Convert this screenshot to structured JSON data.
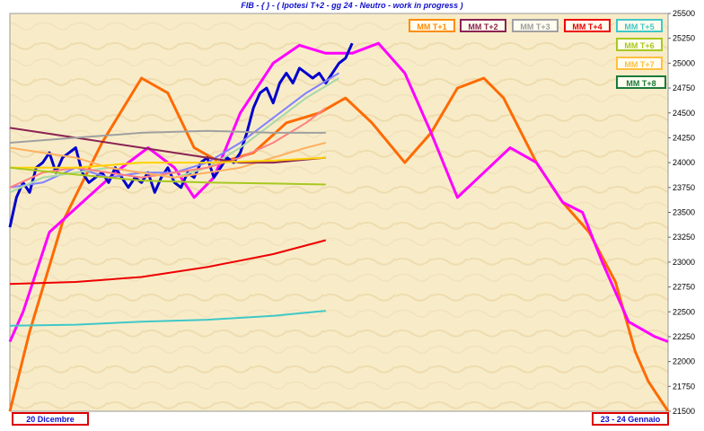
{
  "chart_data": {
    "type": "line",
    "title": "FIB  -  {  }  - ( Ipotesi  T+2 -  gg 24   -  Neutro -  work in progress )",
    "ylim": [
      21500,
      25500
    ],
    "y_ticks": [
      21500,
      21750,
      22000,
      22250,
      22500,
      22750,
      23000,
      23250,
      23500,
      23750,
      24000,
      24250,
      24500,
      24750,
      25000,
      25250,
      25500
    ],
    "x_start_label": "20  Dicembre",
    "x_end_label": "23 - 24  Gennaio",
    "grid": false,
    "legend_position": "top-right",
    "legend": [
      {
        "label": "MM  T+1",
        "color": "#ff8c00"
      },
      {
        "label": "MM  T+2",
        "color": "#8b2252"
      },
      {
        "label": "MM  T+3",
        "color": "#a0a0a0"
      },
      {
        "label": "MM  T+4",
        "color": "#ee0000"
      },
      {
        "label": "MM  T+5",
        "color": "#40c8c8"
      },
      {
        "label": "MM  T+6",
        "color": "#a8c820"
      },
      {
        "label": "MM  T+7",
        "color": "#ffc040"
      },
      {
        "label": "MM  T+8",
        "color": "#1a7a3a"
      }
    ],
    "series": [
      {
        "color": "#ff6a00",
        "x": [
          0,
          0.03,
          0.08,
          0.14,
          0.2,
          0.24,
          0.28,
          0.32,
          0.37,
          0.42,
          0.47,
          0.51,
          0.55,
          0.6,
          0.64,
          0.68,
          0.72,
          0.75,
          0.8,
          0.84,
          0.88,
          0.92,
          0.95,
          0.97,
          1.0
        ],
        "y": [
          21500,
          22300,
          23400,
          24200,
          24850,
          24700,
          24150,
          24000,
          24100,
          24400,
          24500,
          24650,
          24400,
          24000,
          24300,
          24750,
          24850,
          24650,
          24000,
          23600,
          23300,
          22800,
          22100,
          21800,
          21500
        ]
      },
      {
        "color": "#ff00ff",
        "x": [
          0,
          0.02,
          0.06,
          0.11,
          0.16,
          0.21,
          0.25,
          0.28,
          0.31,
          0.35,
          0.4,
          0.44,
          0.48,
          0.52,
          0.56,
          0.6,
          0.64,
          0.68,
          0.72,
          0.76,
          0.8,
          0.84,
          0.87,
          0.9,
          0.94,
          0.98,
          1.0
        ],
        "y": [
          22200,
          22500,
          23300,
          23600,
          23900,
          24150,
          23950,
          23650,
          23850,
          24500,
          25000,
          25180,
          25100,
          25100,
          25200,
          24900,
          24300,
          23650,
          23900,
          24150,
          24000,
          23600,
          23500,
          23000,
          22400,
          22250,
          22200
        ]
      },
      {
        "color": "#0000cc",
        "x": [
          0,
          0.01,
          0.02,
          0.03,
          0.04,
          0.05,
          0.06,
          0.07,
          0.08,
          0.09,
          0.1,
          0.11,
          0.12,
          0.13,
          0.14,
          0.15,
          0.16,
          0.17,
          0.18,
          0.19,
          0.2,
          0.21,
          0.22,
          0.23,
          0.24,
          0.25,
          0.26,
          0.27,
          0.28,
          0.29,
          0.3,
          0.31,
          0.32,
          0.33,
          0.34,
          0.35,
          0.36,
          0.37,
          0.38,
          0.39,
          0.4,
          0.41,
          0.42,
          0.43,
          0.44,
          0.45,
          0.46,
          0.47,
          0.48,
          0.49,
          0.5,
          0.51,
          0.52
        ],
        "y": [
          23350,
          23650,
          23800,
          23700,
          23950,
          24000,
          24100,
          23900,
          24050,
          24100,
          24150,
          23900,
          23800,
          23850,
          23900,
          23800,
          23950,
          23850,
          23750,
          23850,
          23800,
          23900,
          23700,
          23850,
          23950,
          23800,
          23750,
          23900,
          23850,
          24000,
          24050,
          23850,
          23950,
          24050,
          24000,
          24100,
          24300,
          24550,
          24700,
          24750,
          24600,
          24800,
          24900,
          24800,
          24950,
          24900,
          24850,
          24900,
          24800,
          24900,
          25000,
          25050,
          25200
        ]
      },
      {
        "color": "#8080ff",
        "x": [
          0,
          0.05,
          0.1,
          0.15,
          0.2,
          0.25,
          0.3,
          0.35,
          0.4,
          0.45,
          0.5
        ],
        "y": [
          23750,
          23800,
          23950,
          23850,
          23900,
          23900,
          24000,
          24200,
          24450,
          24700,
          24900
        ]
      },
      {
        "color": "#a8d8a8",
        "x": [
          0,
          0.05,
          0.1,
          0.15,
          0.2,
          0.25,
          0.3,
          0.35,
          0.4,
          0.45,
          0.5
        ],
        "y": [
          23700,
          23850,
          23900,
          23950,
          23900,
          23850,
          23950,
          24150,
          24400,
          24650,
          24850
        ]
      },
      {
        "color": "#ff8080",
        "x": [
          0,
          0.05,
          0.1,
          0.15,
          0.2,
          0.25,
          0.3,
          0.35,
          0.4,
          0.45,
          0.48
        ],
        "y": [
          23750,
          23900,
          23950,
          23900,
          23850,
          23900,
          23950,
          24050,
          24200,
          24400,
          24550
        ]
      },
      {
        "color": "#ffb060",
        "x": [
          0,
          0.05,
          0.1,
          0.15,
          0.2,
          0.25,
          0.3,
          0.35,
          0.4,
          0.45,
          0.48
        ],
        "y": [
          24150,
          24100,
          24050,
          23950,
          23900,
          23850,
          23900,
          23950,
          24050,
          24150,
          24200
        ]
      },
      {
        "color": "#8b2252",
        "x": [
          0,
          0.1,
          0.2,
          0.3,
          0.35,
          0.4,
          0.48
        ],
        "y": [
          24350,
          24250,
          24150,
          24050,
          24000,
          24000,
          24050
        ]
      },
      {
        "color": "#a0a0a0",
        "x": [
          0,
          0.1,
          0.2,
          0.3,
          0.4,
          0.48
        ],
        "y": [
          24200,
          24250,
          24300,
          24320,
          24300,
          24300
        ]
      },
      {
        "color": "#ffd000",
        "x": [
          0,
          0.1,
          0.2,
          0.3,
          0.4,
          0.48
        ],
        "y": [
          23950,
          23950,
          24000,
          24000,
          24020,
          24050
        ]
      },
      {
        "color": "#a8c820",
        "x": [
          0,
          0.1,
          0.2,
          0.3,
          0.4,
          0.48
        ],
        "y": [
          23950,
          23880,
          23820,
          23800,
          23790,
          23780
        ]
      },
      {
        "color": "#ee0000",
        "x": [
          0,
          0.1,
          0.2,
          0.3,
          0.4,
          0.48
        ],
        "y": [
          22780,
          22800,
          22850,
          22950,
          23080,
          23220
        ]
      },
      {
        "color": "#40c8c8",
        "x": [
          0,
          0.1,
          0.2,
          0.3,
          0.4,
          0.48
        ],
        "y": [
          22360,
          22370,
          22400,
          22420,
          22460,
          22510
        ]
      }
    ]
  }
}
